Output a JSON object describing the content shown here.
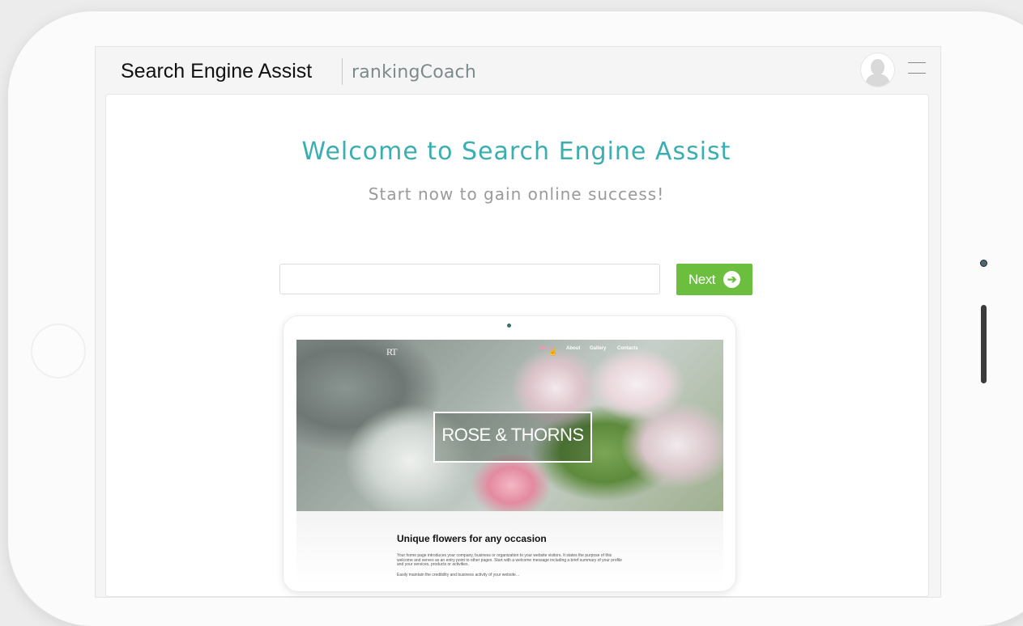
{
  "header": {
    "app_title": "Search Engine Assist",
    "brand": "rankingCoach"
  },
  "main": {
    "welcome_title": "Welcome to Search Engine Assist",
    "subtitle": "Start now to gain online success!",
    "url_input": {
      "value": "",
      "placeholder": ""
    },
    "next_button": "Next"
  },
  "preview": {
    "logo": "RT",
    "nav": [
      "Home",
      "About",
      "Gallery",
      "Contacts"
    ],
    "hero_title": "ROSE & THORNS",
    "heading": "Unique flowers for any occasion",
    "paragraph1": "Your home page introduces your company, business or organization to your website visitors. It states the purpose of this welcome and serves as an entry point to other pages. Start with a welcome message including a brief summary of your profile and your services, products or activities.",
    "paragraph2": "Easily maintain the credibility and business activity of your website…"
  },
  "colors": {
    "accent": "#3aaeb0",
    "next_button": "#6cbf3e",
    "nav_active": "#f19bb0"
  }
}
